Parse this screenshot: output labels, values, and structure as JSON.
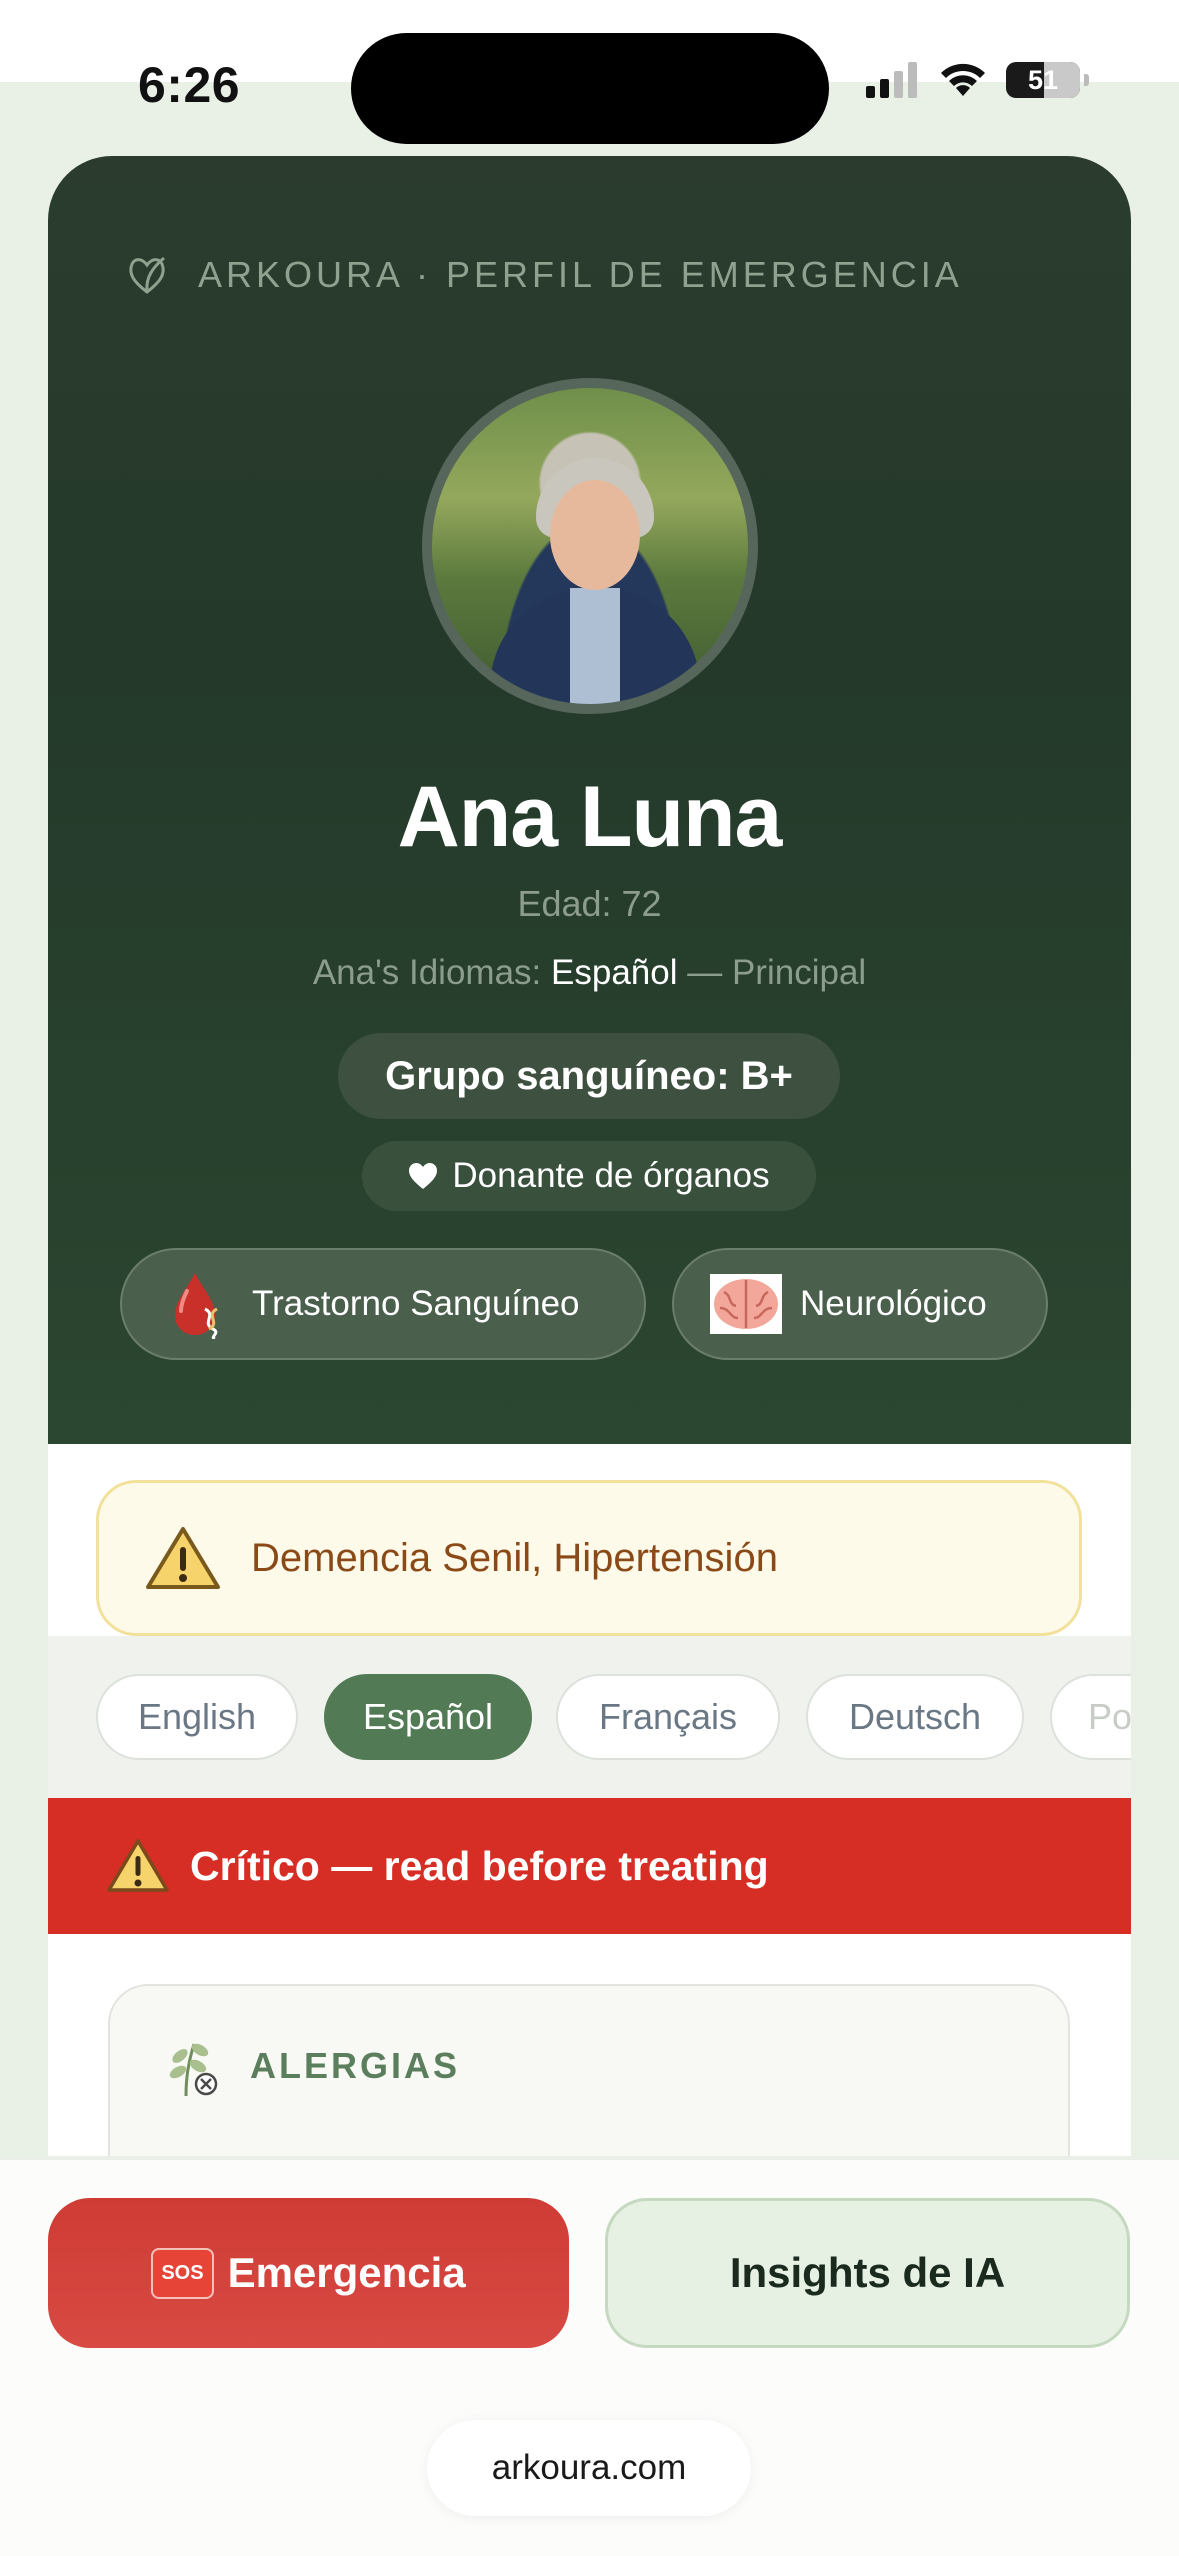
{
  "status_bar": {
    "time": "6:26",
    "battery": "51"
  },
  "header": {
    "brand": "ARKOURA · PERFIL DE EMERGENCIA"
  },
  "profile": {
    "name": "Ana Luna",
    "age": "Edad: 72",
    "languages_prefix": "Ana's Idiomas:",
    "languages_main": "Español",
    "languages_suffix": "— Principal",
    "blood_type": "Grupo sanguíneo: B+",
    "donor": "Donante de órganos",
    "conditions": [
      {
        "label": "Trastorno Sanguíneo",
        "icon": "blood-drop-dna-icon"
      },
      {
        "label": "Neurológico",
        "icon": "brain-icon"
      }
    ]
  },
  "warning": {
    "text": "Demencia Senil, Hipertensión",
    "icon": "warning-icon"
  },
  "language_tabs": {
    "items": [
      "English",
      "Español",
      "Français",
      "Deutsch",
      "Po"
    ],
    "active": "Español"
  },
  "critical_banner": {
    "text": "Crítico — read before treating"
  },
  "allergies": {
    "title": "ALERGIAS"
  },
  "actions": {
    "emergency_badge": "SOS",
    "emergency_label": "Emergencia",
    "ai_label": "Insights de IA"
  },
  "browser": {
    "url": "arkoura.com"
  },
  "colors": {
    "hero": "#24392a",
    "accent_green": "#527b55",
    "critical_red": "#d62e25",
    "warning_bg": "#fefae9"
  }
}
